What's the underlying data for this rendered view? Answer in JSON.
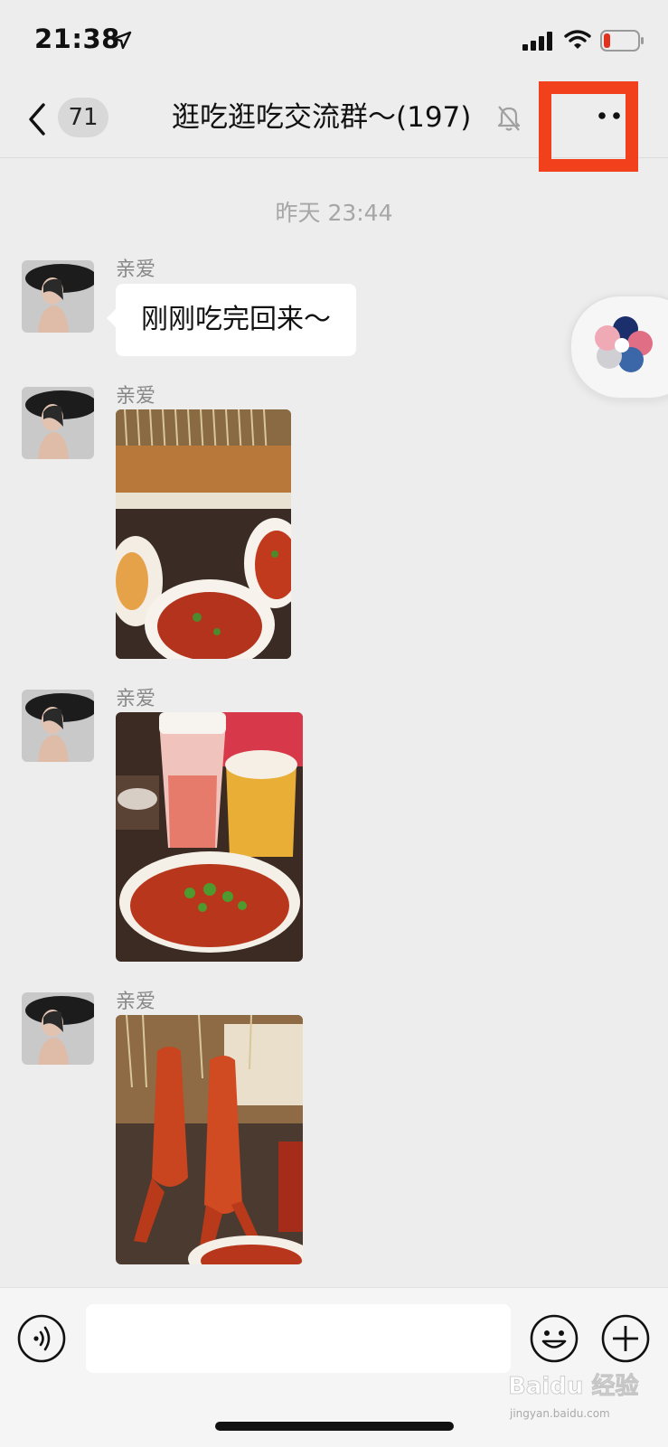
{
  "status_bar": {
    "time": "21:38",
    "location_icon": "location-arrow-icon",
    "signal_icon": "cellular-signal-icon",
    "wifi_icon": "wifi-icon",
    "battery_icon": "battery-low-icon",
    "battery_color": "#e0321e"
  },
  "nav": {
    "back_icon": "chevron-left-icon",
    "unread_count": "71",
    "title": "逛吃逛吃交流群～(197)",
    "mute_icon": "bell-muted-icon",
    "more_icon": "more-dots-icon",
    "highlight_color": "#f2401c"
  },
  "chat": {
    "timestamp": "昨天 23:44",
    "messages": [
      {
        "type": "text",
        "sender": "亲爱",
        "text": "刚刚吃完回来～"
      },
      {
        "type": "image",
        "sender": "亲爱",
        "image": "skewers-and-dishes-photo"
      },
      {
        "type": "image",
        "sender": "亲爱",
        "image": "drinks-and-soup-photo"
      },
      {
        "type": "image",
        "sender": "亲爱",
        "image": "crayfish-skewers-photo"
      }
    ]
  },
  "floating_widget": {
    "icon": "multi-petal-floating-icon"
  },
  "input_bar": {
    "voice_icon": "voice-icon",
    "input_value": "",
    "emoji_icon": "emoji-icon",
    "plus_icon": "plus-circle-icon"
  },
  "watermark": {
    "text": "Baidu 经验",
    "subtext": "jingyan.baidu.com"
  },
  "colors": {
    "background": "#ededed",
    "bubble": "#ffffff",
    "accent_red": "#f2401c"
  }
}
